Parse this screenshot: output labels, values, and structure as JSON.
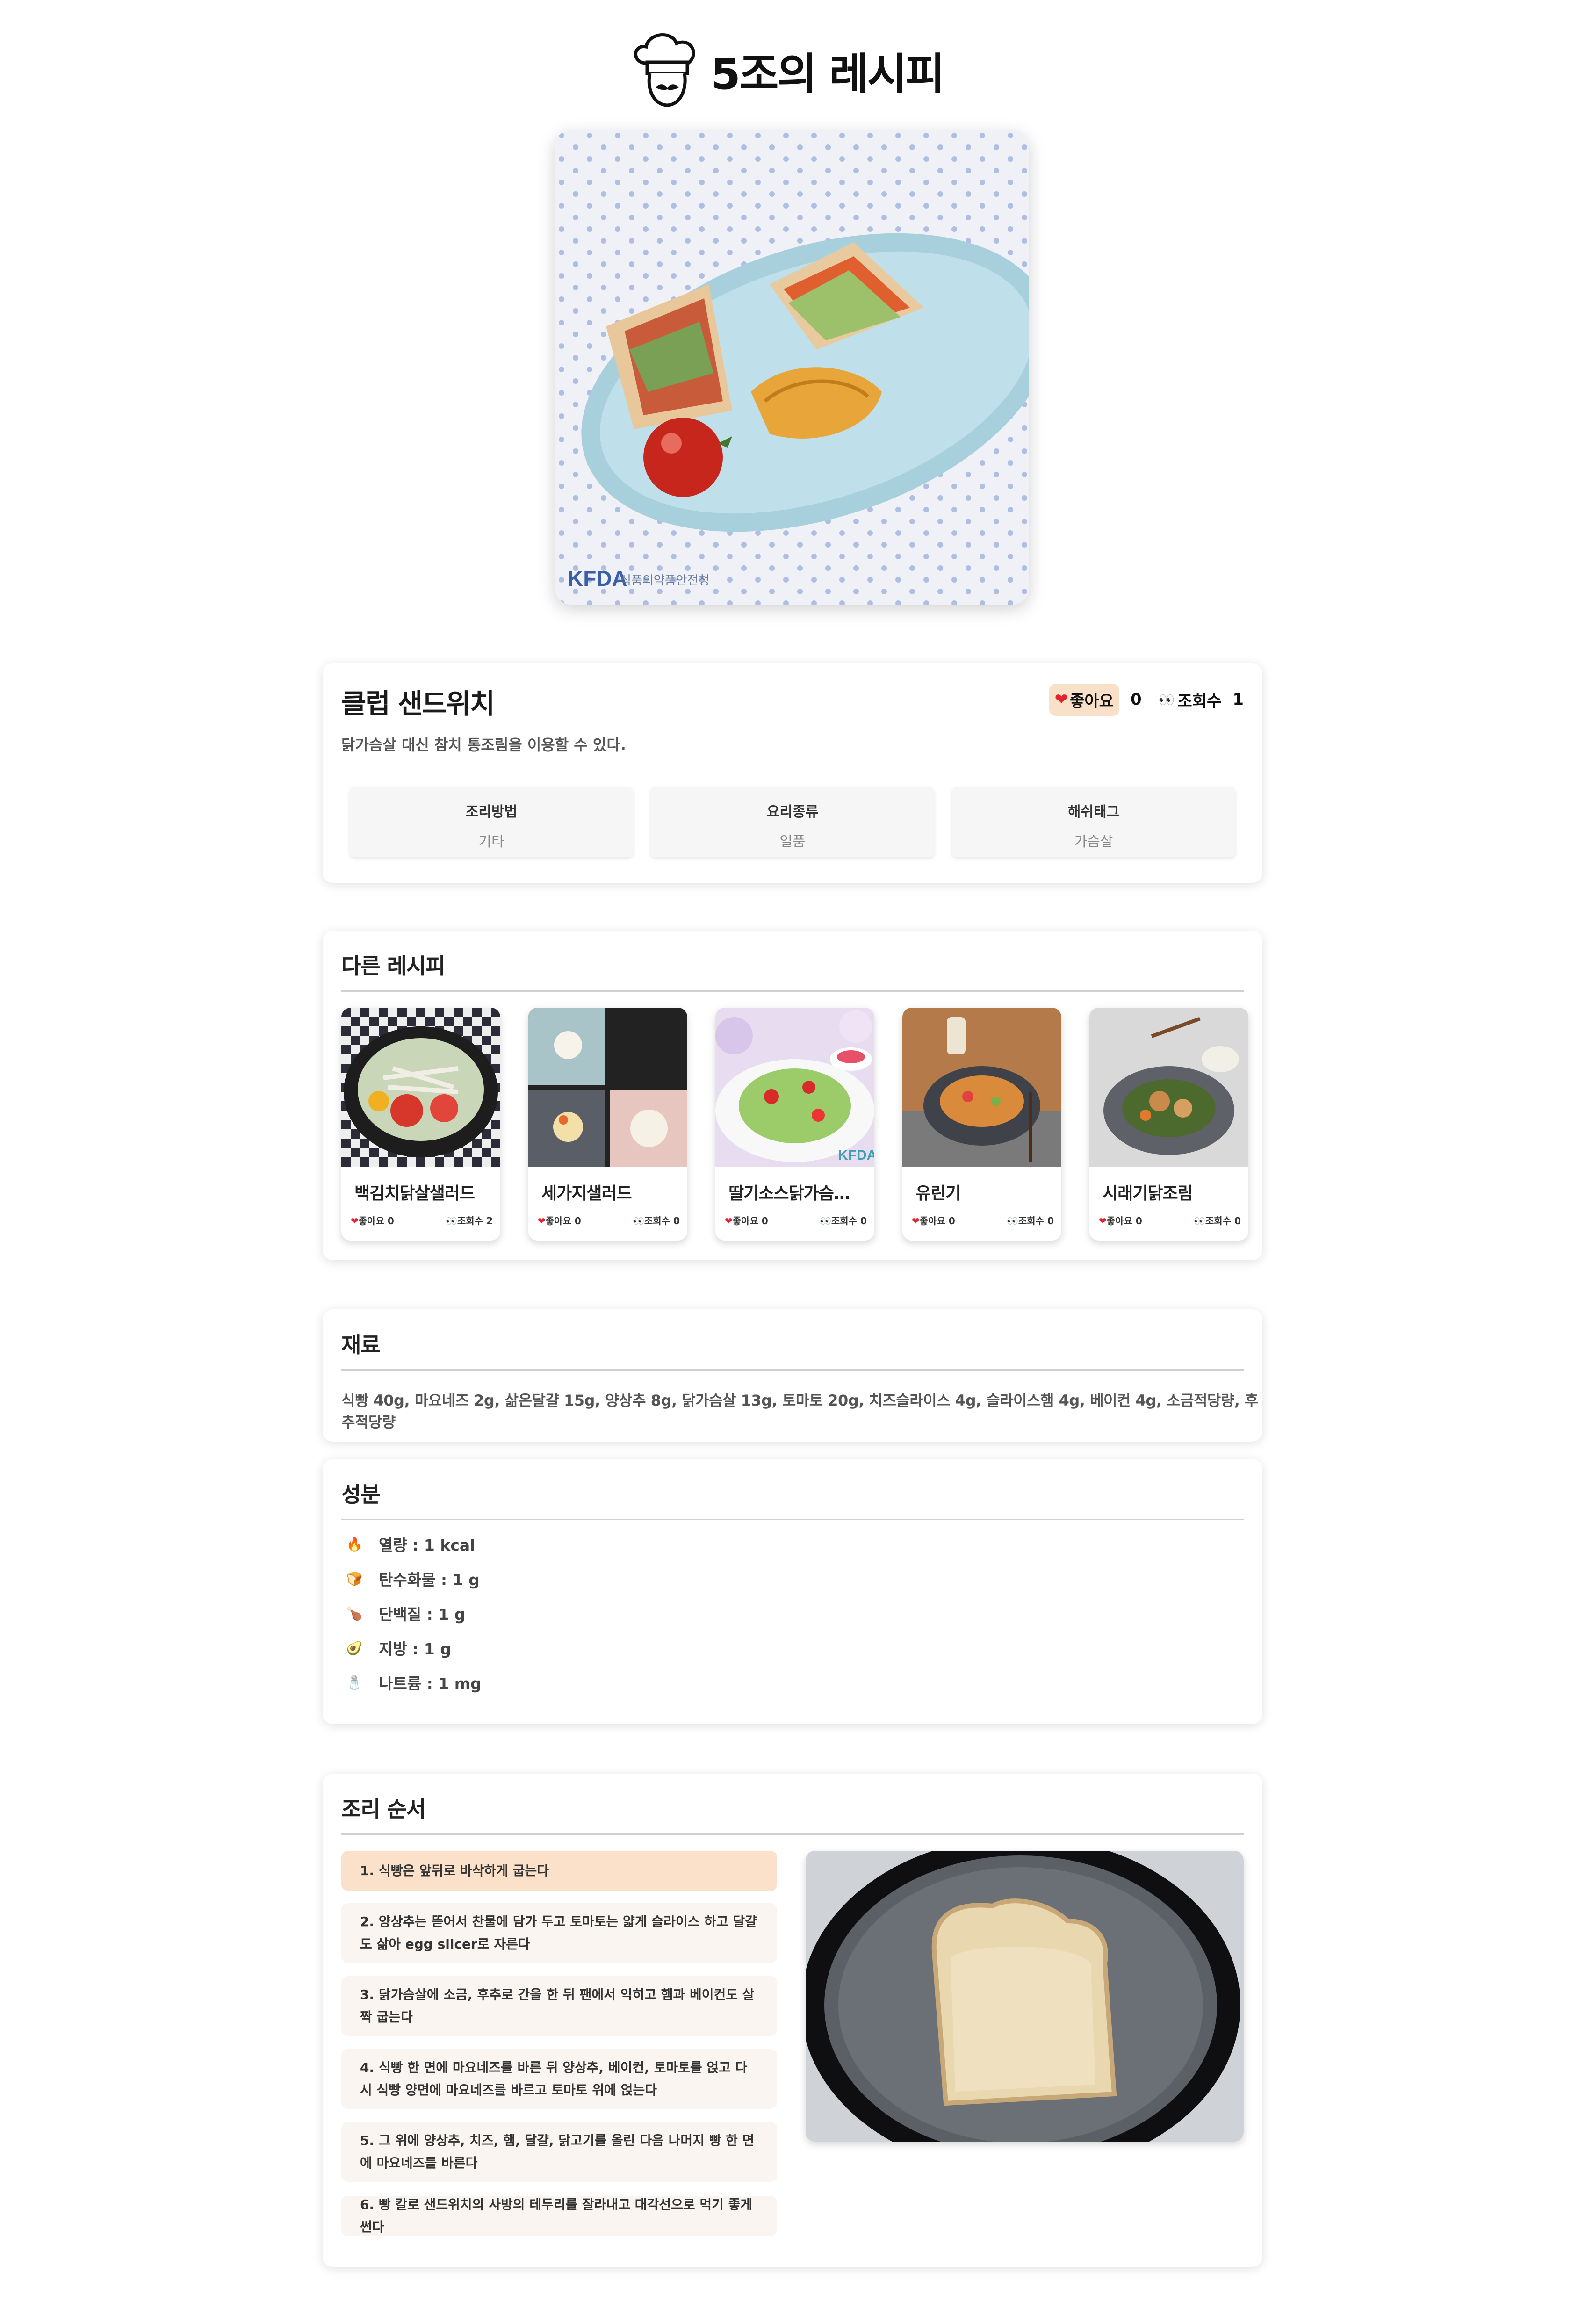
{
  "site": {
    "title": "5조의 레시피",
    "logo_icon": "chef-hat-mustache-icon"
  },
  "recipe": {
    "name": "클럽 샌드위치",
    "description": "닭가슴살 대신 참치 통조림을 이용할 수 있다.",
    "like_label": "좋아요",
    "like_count": "0",
    "view_label": "조회수",
    "view_count": "1",
    "meta": [
      {
        "key": "조리방법",
        "value": "기타"
      },
      {
        "key": "요리종류",
        "value": "일품"
      },
      {
        "key": "해쉬태그",
        "value": "가슴살"
      }
    ]
  },
  "others": {
    "heading": "다른 레시피",
    "items": [
      {
        "title": "백김치닭살샐러드",
        "likes": "좋아요 0",
        "views": "조회수 2"
      },
      {
        "title": "세가지샐러드",
        "likes": "좋아요 0",
        "views": "조회수 0"
      },
      {
        "title": "딸기소스닭가슴살…",
        "likes": "좋아요 0",
        "views": "조회수 0"
      },
      {
        "title": "유린기",
        "likes": "좋아요 0",
        "views": "조회수 0"
      },
      {
        "title": "시래기닭조림",
        "likes": "좋아요 0",
        "views": "조회수 0"
      }
    ]
  },
  "ingredients": {
    "heading": "재료",
    "text": "식빵 40g, 마요네즈 2g, 삶은달걀 15g, 양상추 8g, 닭가슴살 13g, 토마토 20g, 치즈슬라이스 4g, 슬라이스햄 4g, 베이컨 4g, 소금적당량, 후추적당량"
  },
  "nutrients": {
    "heading": "성분",
    "items": [
      {
        "icon": "🔥",
        "text": "열량 : 1 kcal"
      },
      {
        "icon": "🍞",
        "text": "탄수화물 : 1 g"
      },
      {
        "icon": "🍗",
        "text": "단백질 : 1 g"
      },
      {
        "icon": "🥑",
        "text": "지방 : 1 g"
      },
      {
        "icon": "🧂",
        "text": "나트륨 : 1 mg"
      }
    ]
  },
  "steps": {
    "heading": "조리 순서",
    "items": [
      "1. 식빵은 앞뒤로 바삭하게 굽는다",
      "2. 양상추는 뜯어서 찬물에 담가 두고 토마토는 얇게 슬라이스 하고 달걀도 삶아 egg slicer로 자른다",
      "3. 닭가슴살에 소금, 후추로 간을 한 뒤 팬에서 익히고 햄과 베이컨도 살짝 굽는다",
      "4. 식빵 한 면에 마요네즈를 바른 뒤 양상추, 베이컨, 토마토를 얹고 다시 식빵 양면에 마요네즈를 바르고 토마토 위에 얹는다",
      "5. 그 위에 양상추, 치즈, 햄, 달걀, 닭고기를 올린 다음 나머지 빵 한 면에 마요네즈를 바른다",
      "6. 빵 칼로 샌드위치의 사방의 테두리를 잘라내고 대각선으로 먹기 좋게 썬다"
    ]
  },
  "colors": {
    "like_chip": "#f9e0c8",
    "active_step": "#fbe1c9",
    "step_bg": "#faf5f0",
    "heart": "#e0242f"
  }
}
